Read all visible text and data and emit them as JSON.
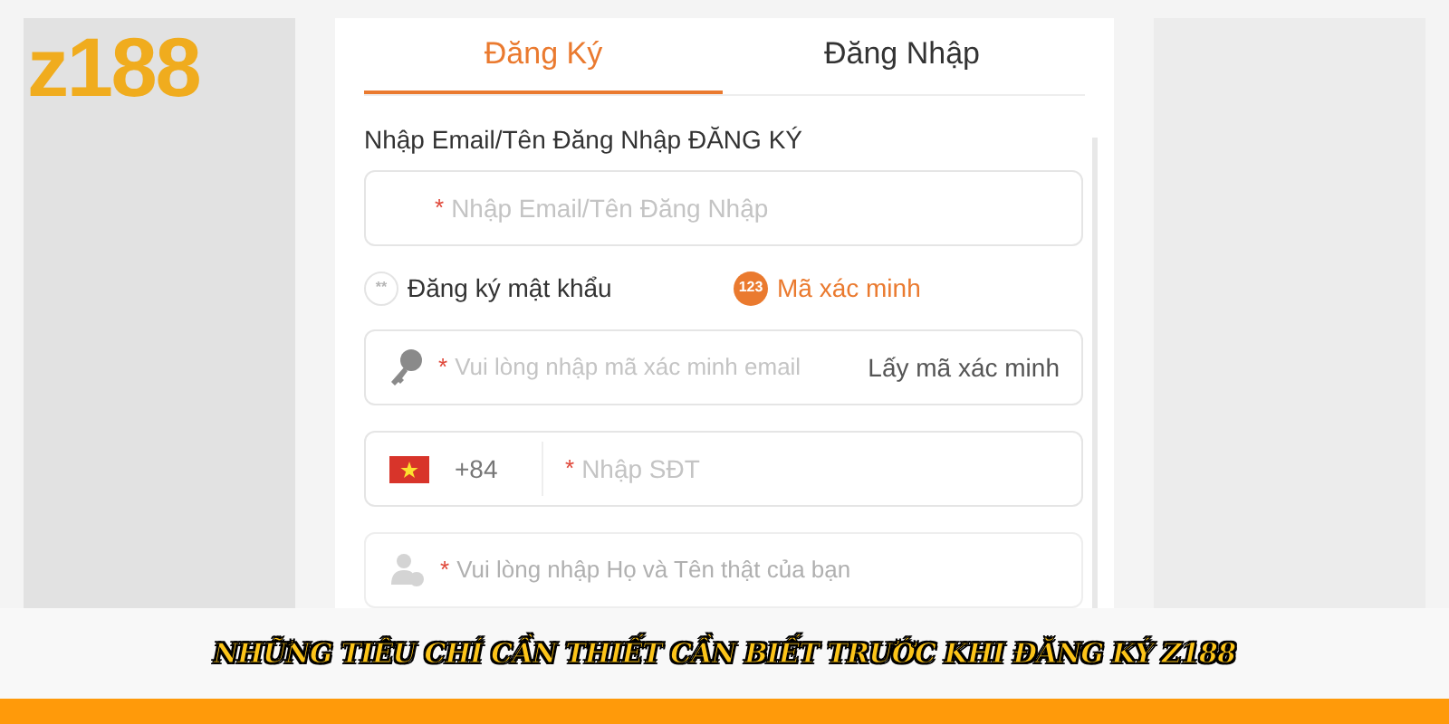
{
  "logo": "z188",
  "tabs": [
    {
      "label": "Đăng Ký",
      "selected": true
    },
    {
      "label": "Đăng Nhập",
      "selected": false
    }
  ],
  "field_label": "Nhập Email/Tên Đăng Nhập ĐĂNG KÝ",
  "email_field": {
    "required_mark": "*",
    "placeholder": "Nhập Email/Tên Đăng Nhập"
  },
  "methods": [
    {
      "label": "Đăng ký mật khẩu",
      "badge": "**",
      "selected": false
    },
    {
      "label": "Mã xác minh",
      "badge": "123",
      "selected": true
    }
  ],
  "code_field": {
    "required_mark": "*",
    "placeholder": "Vui lòng nhập mã xác minh email",
    "action": "Lấy mã xác minh"
  },
  "phone_field": {
    "prefix": "+84",
    "required_mark": "*",
    "placeholder": "Nhập SĐT"
  },
  "name_field": {
    "required_mark": "*",
    "placeholder": "Vui lòng nhập Họ và Tên thật của bạn"
  },
  "caption": "NHỮNG TIÊU CHÍ CẦN THIẾT CẦN BIẾT TRƯỚC KHI ĐĂNG KÝ Z188"
}
